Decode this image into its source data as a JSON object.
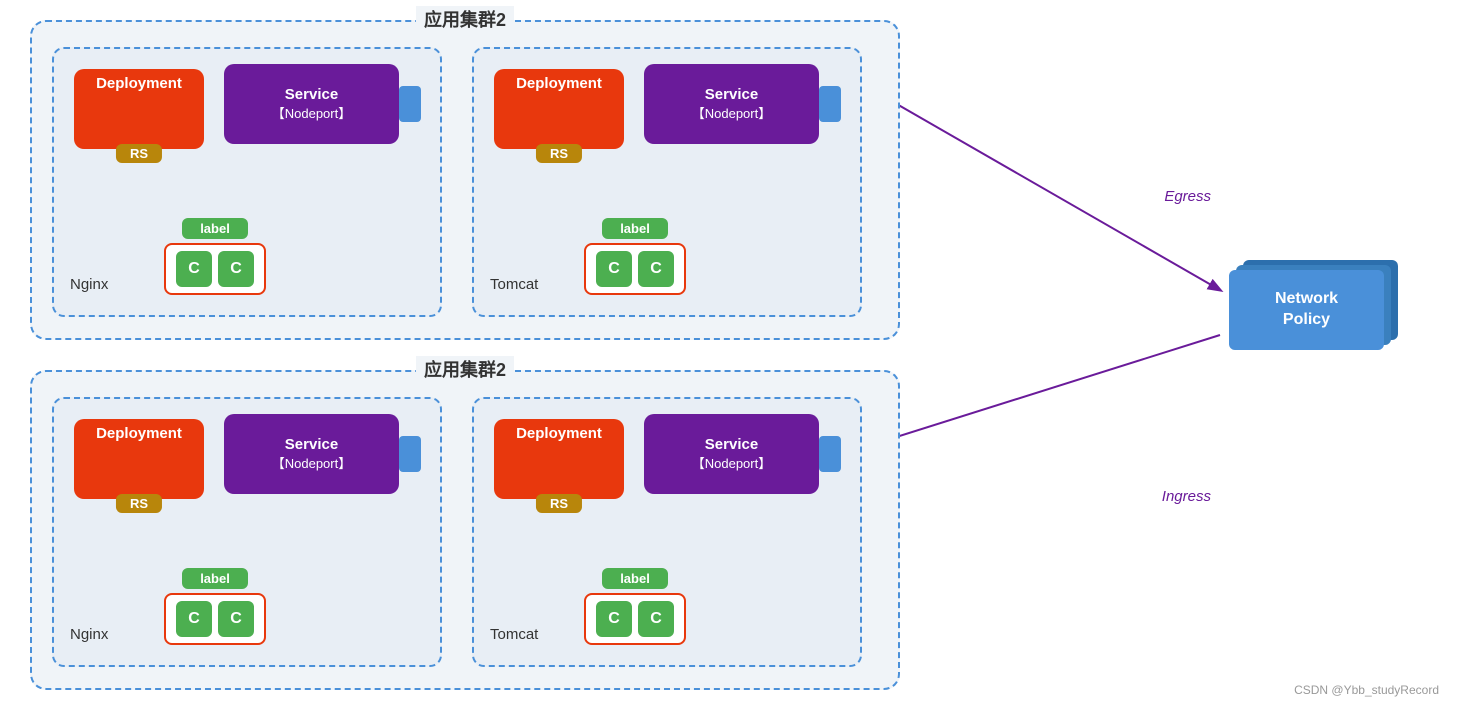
{
  "topCluster": {
    "title": "应用集群2",
    "leftPod": {
      "type": "Nginx",
      "deployment": "Deployment",
      "rs": "RS",
      "service": "Service",
      "nodeport": "【Nodeport】",
      "label": "label",
      "containers": [
        "C",
        "C"
      ]
    },
    "rightPod": {
      "type": "Tomcat",
      "deployment": "Deployment",
      "rs": "RS",
      "service": "Service",
      "nodeport": "【Nodeport】",
      "label": "label",
      "containers": [
        "C",
        "C"
      ]
    }
  },
  "bottomCluster": {
    "title": "应用集群2",
    "leftPod": {
      "type": "Nginx",
      "deployment": "Deployment",
      "rs": "RS",
      "service": "Service",
      "nodeport": "【Nodeport】",
      "label": "label",
      "containers": [
        "C",
        "C"
      ]
    },
    "rightPod": {
      "type": "Tomcat",
      "deployment": "Deployment",
      "rs": "RS",
      "service": "Service",
      "nodeport": "【Nodeport】",
      "label": "label",
      "containers": [
        "C",
        "C"
      ]
    }
  },
  "networkPolicy": {
    "line1": "Network",
    "line2": "Policy"
  },
  "egress": "Egress",
  "ingress": "Ingress",
  "watermark": "CSDN @Ybb_studyRecord"
}
